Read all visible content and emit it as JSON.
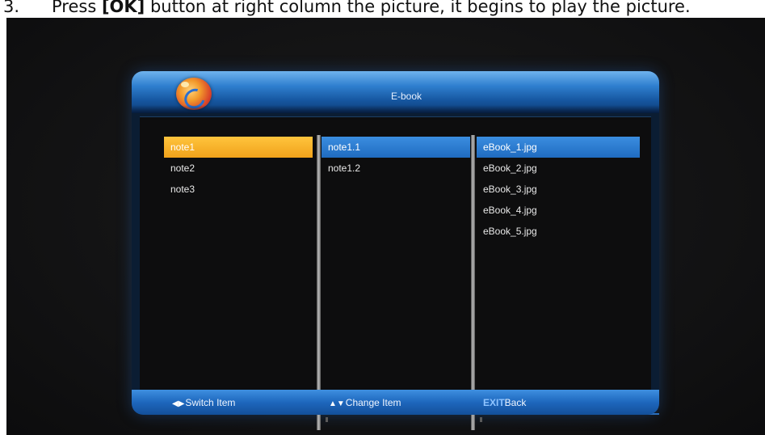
{
  "caption": {
    "number": "3.",
    "pre": "Press ",
    "key": "[OK]",
    "post": " button at right column the picture, it begins to play the picture."
  },
  "window": {
    "title": "E-book"
  },
  "columns": {
    "folders": [
      "note1",
      "note2",
      "note3"
    ],
    "subfolders": [
      "note1.1",
      "note1.2"
    ],
    "files": [
      "eBook_1.jpg",
      "eBook_2.jpg",
      "eBook_3.jpg",
      "eBook_4.jpg",
      "eBook_5.jpg"
    ]
  },
  "footer": {
    "switch_key": "◀▶",
    "switch_label": "Switch Item",
    "change_key": "▲▼",
    "change_label": "Change Item",
    "exit_key": "EXIT",
    "exit_label": "Back"
  },
  "colors": {
    "focus": "#f0a21b",
    "selected": "#1f6bc0",
    "header": "#2f7fcf"
  },
  "icons": [
    "logo-icon",
    "left-right-arrow-icon",
    "up-down-arrow-icon"
  ]
}
